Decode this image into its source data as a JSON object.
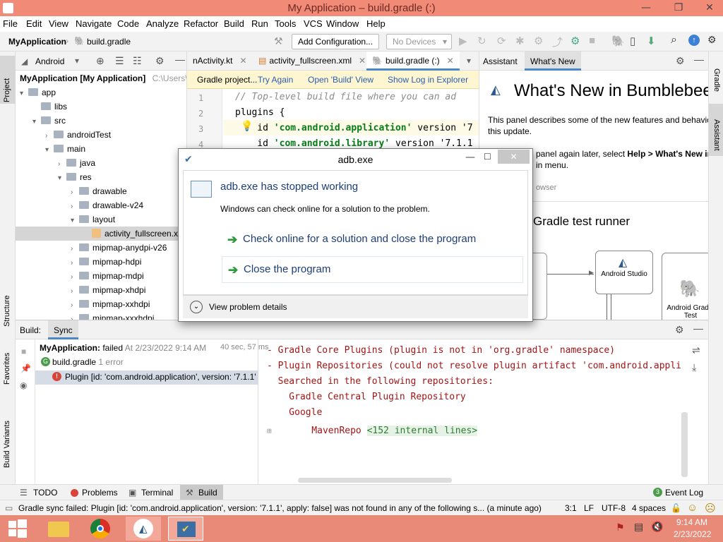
{
  "window": {
    "title": "My Application – build.gradle (:)",
    "minimize": "—",
    "restore": "❐",
    "close": "✕"
  },
  "menu": [
    "File",
    "Edit",
    "View",
    "Navigate",
    "Code",
    "Analyze",
    "Refactor",
    "Build",
    "Run",
    "Tools",
    "VCS",
    "Window",
    "Help"
  ],
  "toolbar": {
    "project": "MyApplication",
    "file": "build.gradle",
    "add_config": "Add Configuration...",
    "devices": "No Devices"
  },
  "sidestrip": {
    "project": "Project",
    "structure": "Structure",
    "favorites": "Favorites",
    "build_variants": "Build Variants",
    "gradle": "Gradle",
    "assistant": "Assistant"
  },
  "project": {
    "view": "Android",
    "root_name": "MyApplication [My Application]",
    "root_path": "C:\\Users\\VM",
    "items": [
      {
        "label": "app",
        "depth": 0,
        "open": true,
        "type": "folder"
      },
      {
        "label": "libs",
        "depth": 1,
        "open": false,
        "type": "folder",
        "noarrow": true
      },
      {
        "label": "src",
        "depth": 1,
        "open": true,
        "type": "folder"
      },
      {
        "label": "androidTest",
        "depth": 2,
        "open": false,
        "type": "folder"
      },
      {
        "label": "main",
        "depth": 2,
        "open": true,
        "type": "folder"
      },
      {
        "label": "java",
        "depth": 3,
        "open": false,
        "type": "folder"
      },
      {
        "label": "res",
        "depth": 3,
        "open": true,
        "type": "folder"
      },
      {
        "label": "drawable",
        "depth": 4,
        "open": false,
        "type": "folder"
      },
      {
        "label": "drawable-v24",
        "depth": 4,
        "open": false,
        "type": "folder"
      },
      {
        "label": "layout",
        "depth": 4,
        "open": true,
        "type": "folder"
      },
      {
        "label": "activity_fullscreen.xml",
        "depth": 5,
        "open": false,
        "type": "file",
        "selected": true
      },
      {
        "label": "mipmap-anydpi-v26",
        "depth": 4,
        "open": false,
        "type": "folder"
      },
      {
        "label": "mipmap-hdpi",
        "depth": 4,
        "open": false,
        "type": "folder"
      },
      {
        "label": "mipmap-mdpi",
        "depth": 4,
        "open": false,
        "type": "folder"
      },
      {
        "label": "mipmap-xhdpi",
        "depth": 4,
        "open": false,
        "type": "folder"
      },
      {
        "label": "mipmap-xxhdpi",
        "depth": 4,
        "open": false,
        "type": "folder"
      },
      {
        "label": "mipmap-xxxhdpi",
        "depth": 4,
        "open": false,
        "type": "folder"
      }
    ]
  },
  "editor": {
    "tabs": [
      {
        "label": "nActivity.kt"
      },
      {
        "label": "activity_fullscreen.xml"
      },
      {
        "label": "build.gradle (:)",
        "active": true
      }
    ],
    "notification": {
      "text": "Gradle project...",
      "try_again": "Try Again",
      "open_build": "Open 'Build' View",
      "show_log": "Show Log in Explorer"
    },
    "lines": [
      {
        "n": "1",
        "text": "// Top-level build file where you can ad"
      },
      {
        "n": "2",
        "text": "plugins {"
      },
      {
        "n": "3",
        "prefix": "    id ",
        "str": "'com.android.application'",
        "suffix": " version '7"
      },
      {
        "n": "4",
        "prefix": "    id ",
        "str": "'com.android.library'",
        "suffix": " version '7.1.1"
      }
    ]
  },
  "assistant": {
    "tab1": "Assistant",
    "tab2": "What's New",
    "heading": "What's New in Bumblebee",
    "para1": "This panel describes some of the new features and behavior",
    "para1b": "this update.",
    "para2a": "panel again later, select ",
    "para2b": "Help > What's New in",
    "para2c": "in menu.",
    "browser": "owser",
    "section": "Gradle test runner",
    "box1": "Android Studio",
    "box2": "Android Gradle Test"
  },
  "dialog": {
    "title": "adb.exe",
    "heading": "adb.exe has stopped working",
    "subtext": "Windows can check online for a solution to the problem.",
    "option1": "Check online for a solution and close the program",
    "option2": "Close the program",
    "details": "View problem details"
  },
  "build": {
    "tab_build": "Build:",
    "tab_sync": "Sync",
    "root": "MyApplication:",
    "root_status": "failed",
    "root_time": "At 2/23/2022 9:14 AM",
    "duration": "40 sec, 57 ms",
    "file": "build.gradle",
    "errors": "1 error",
    "error_msg": "Plugin [id: 'com.android.application', version: '7.1.1'",
    "output": [
      "- Gradle Core Plugins (plugin is not in 'org.gradle' namespace)",
      "- Plugin Repositories (could not resolve plugin artifact 'com.android.appli",
      "  Searched in the following repositories:",
      "    Gradle Central Plugin Repository",
      "    Google",
      "    MavenRepo "
    ],
    "internal_lines": "<152 internal lines>"
  },
  "bottom_tabs": {
    "todo": "TODO",
    "problems": "Problems",
    "terminal": "Terminal",
    "build": "Build",
    "event_log": "Event Log",
    "event_count": "3"
  },
  "status": {
    "message": "Gradle sync failed: Plugin [id: 'com.android.application', version: '7.1.1', apply: false] was not found in any of the following s... (a minute ago)",
    "position": "3:1",
    "line_sep": "LF",
    "encoding": "UTF-8",
    "indent": "4 spaces"
  },
  "taskbar": {
    "time": "9:14 AM",
    "date": "2/23/2022"
  },
  "colors": {
    "titlebar": "#f28a78",
    "taskbar": "#e98a78",
    "link": "#2a5db0",
    "error": "#a31515",
    "string": "#067d17"
  }
}
